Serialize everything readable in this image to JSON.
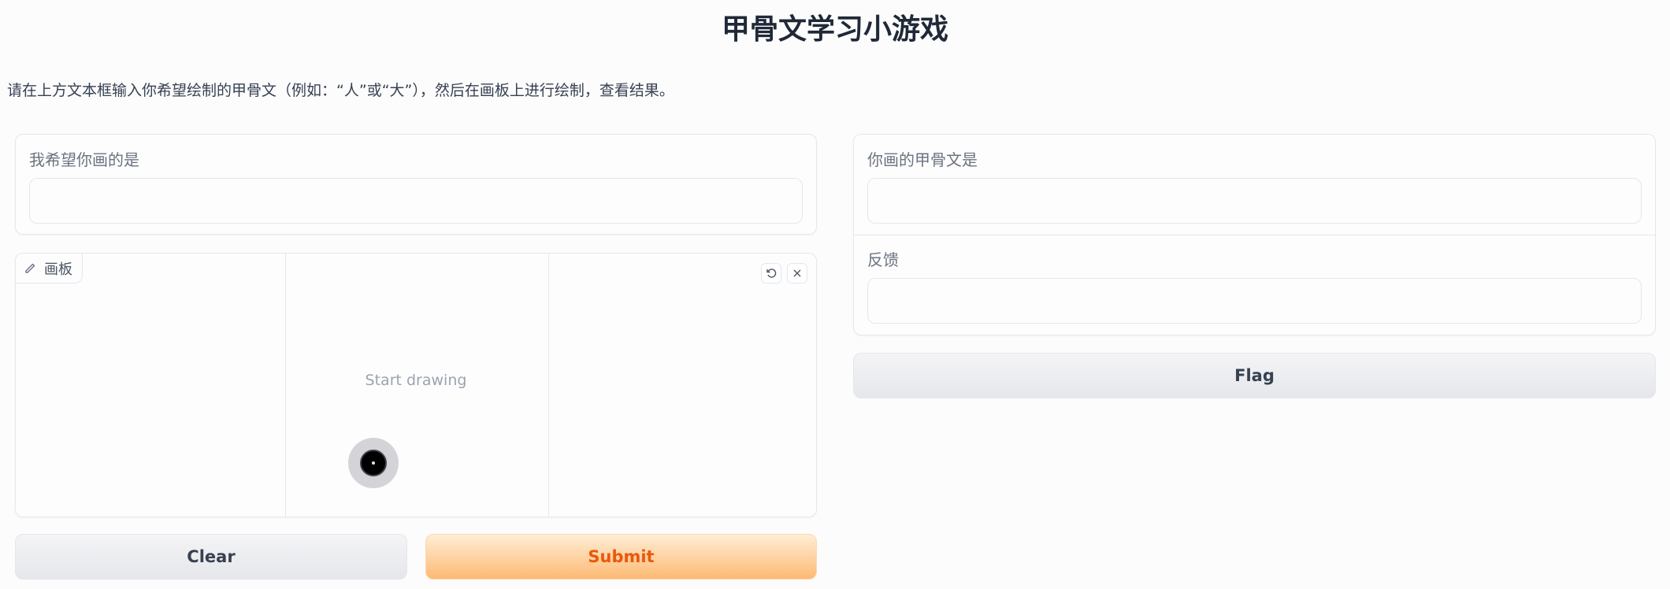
{
  "page": {
    "title": "甲骨文学习小游戏",
    "description": "请在上方文本框输入你希望绘制的甲骨文（例如：“人”或“大”），然后在画板上进行绘制，查看结果。"
  },
  "input_panel": {
    "label": "我希望你画的是",
    "value": ""
  },
  "canvas": {
    "tab_label": "画板",
    "placeholder": "Start drawing",
    "tab_icon": "pencil-icon",
    "undo_icon": "undo-icon",
    "clear_icon": "close-icon"
  },
  "buttons": {
    "clear": "Clear",
    "submit": "Submit",
    "flag": "Flag"
  },
  "output_panel": {
    "result_label": "你画的甲骨文是",
    "result_value": "",
    "feedback_label": "反馈",
    "feedback_value": ""
  }
}
